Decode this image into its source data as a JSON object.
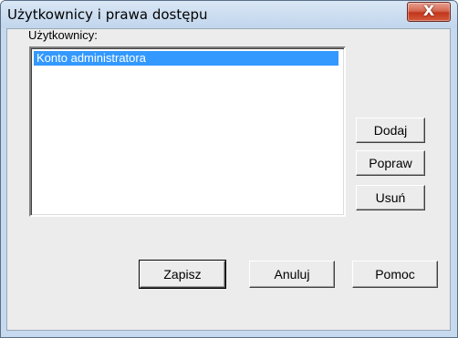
{
  "window": {
    "title": "Użytkownicy i prawa dostępu",
    "close_glyph": "X"
  },
  "users": {
    "label": "Użytkownicy:",
    "items": [
      {
        "label": "Konto administratora",
        "selected": true
      }
    ]
  },
  "side_buttons": {
    "add": "Dodaj",
    "edit": "Popraw",
    "delete": "Usuń"
  },
  "footer_buttons": {
    "save": "Zapisz",
    "cancel": "Anuluj",
    "help": "Pomoc"
  },
  "colors": {
    "selection": "#3399ff",
    "close_button": "#c2351c",
    "dialog_bg": "#ececec"
  },
  "icons": {
    "close": "close-icon"
  }
}
